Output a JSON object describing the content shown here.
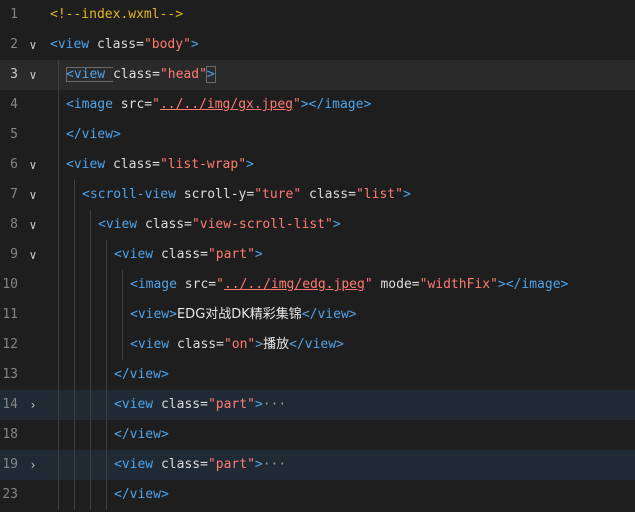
{
  "lines": [
    {
      "num": "1",
      "fold": "",
      "code": [
        {
          "t": "comment",
          "v": "<!--index.wxml-->"
        }
      ]
    },
    {
      "num": "2",
      "fold": "open",
      "code": [
        {
          "t": "tag",
          "v": "<view "
        },
        {
          "t": "attr",
          "v": "class"
        },
        {
          "t": "eq",
          "v": "="
        },
        {
          "t": "str",
          "v": "\"body\""
        },
        {
          "t": "tag",
          "v": ">"
        }
      ]
    },
    {
      "num": "3",
      "fold": "open",
      "current": true,
      "code": [
        {
          "t": "tag",
          "v": "<view "
        },
        {
          "t": "attr",
          "v": "class"
        },
        {
          "t": "eq",
          "v": "="
        },
        {
          "t": "str",
          "v": "\"head\""
        },
        {
          "t": "tag",
          "v": ">"
        }
      ]
    },
    {
      "num": "4",
      "fold": "",
      "code": [
        {
          "t": "tag",
          "v": "<image "
        },
        {
          "t": "attr",
          "v": "src"
        },
        {
          "t": "eq",
          "v": "="
        },
        {
          "t": "str",
          "v": "\""
        },
        {
          "t": "link",
          "v": "../../img/gx.jpeg"
        },
        {
          "t": "str",
          "v": "\""
        },
        {
          "t": "tag",
          "v": "></image>"
        }
      ]
    },
    {
      "num": "5",
      "fold": "",
      "code": [
        {
          "t": "tag",
          "v": "</view>"
        }
      ]
    },
    {
      "num": "6",
      "fold": "open",
      "code": [
        {
          "t": "tag",
          "v": "<view "
        },
        {
          "t": "attr",
          "v": "class"
        },
        {
          "t": "eq",
          "v": "="
        },
        {
          "t": "str",
          "v": "\"list-wrap\""
        },
        {
          "t": "tag",
          "v": ">"
        }
      ]
    },
    {
      "num": "7",
      "fold": "open",
      "code": [
        {
          "t": "tag",
          "v": "<scroll-view "
        },
        {
          "t": "attr",
          "v": "scroll-y"
        },
        {
          "t": "eq",
          "v": "="
        },
        {
          "t": "str",
          "v": "\"ture\""
        },
        {
          "t": "attr",
          "v": " class"
        },
        {
          "t": "eq",
          "v": "="
        },
        {
          "t": "str",
          "v": "\"list\""
        },
        {
          "t": "tag",
          "v": ">"
        }
      ]
    },
    {
      "num": "8",
      "fold": "open",
      "code": [
        {
          "t": "tag",
          "v": "<view "
        },
        {
          "t": "attr",
          "v": "class"
        },
        {
          "t": "eq",
          "v": "="
        },
        {
          "t": "str",
          "v": "\"view-scroll-list\""
        },
        {
          "t": "tag",
          "v": ">"
        }
      ]
    },
    {
      "num": "9",
      "fold": "open",
      "code": [
        {
          "t": "tag",
          "v": "<view "
        },
        {
          "t": "attr",
          "v": "class"
        },
        {
          "t": "eq",
          "v": "="
        },
        {
          "t": "str",
          "v": "\"part\""
        },
        {
          "t": "tag",
          "v": ">"
        }
      ]
    },
    {
      "num": "10",
      "fold": "",
      "code": [
        {
          "t": "tag",
          "v": "<image "
        },
        {
          "t": "attr",
          "v": "src"
        },
        {
          "t": "eq",
          "v": "="
        },
        {
          "t": "str",
          "v": "\""
        },
        {
          "t": "link",
          "v": "../../img/edg.jpeg"
        },
        {
          "t": "str",
          "v": "\""
        },
        {
          "t": "attr",
          "v": " mode"
        },
        {
          "t": "eq",
          "v": "="
        },
        {
          "t": "str",
          "v": "\"widthFix\""
        },
        {
          "t": "tag",
          "v": "></image>"
        }
      ]
    },
    {
      "num": "11",
      "fold": "",
      "code": [
        {
          "t": "tag",
          "v": "<view>"
        },
        {
          "t": "text",
          "v": "EDG对战DK精彩集锦"
        },
        {
          "t": "tag",
          "v": "</view>"
        }
      ]
    },
    {
      "num": "12",
      "fold": "",
      "code": [
        {
          "t": "tag",
          "v": "<view "
        },
        {
          "t": "attr",
          "v": "class"
        },
        {
          "t": "eq",
          "v": "="
        },
        {
          "t": "str",
          "v": "\"on\""
        },
        {
          "t": "tag",
          "v": ">"
        },
        {
          "t": "text",
          "v": "播放"
        },
        {
          "t": "tag",
          "v": "</view>"
        }
      ]
    },
    {
      "num": "13",
      "fold": "",
      "code": [
        {
          "t": "tag",
          "v": "</view>"
        }
      ]
    },
    {
      "num": "14",
      "fold": "closed",
      "folded": true,
      "code": [
        {
          "t": "tag",
          "v": "<view "
        },
        {
          "t": "attr",
          "v": "class"
        },
        {
          "t": "eq",
          "v": "="
        },
        {
          "t": "str",
          "v": "\"part\""
        },
        {
          "t": "tag",
          "v": ">"
        },
        {
          "t": "ell",
          "v": "···"
        }
      ]
    },
    {
      "num": "18",
      "fold": "",
      "code": [
        {
          "t": "tag",
          "v": "</view>"
        }
      ]
    },
    {
      "num": "19",
      "fold": "closed",
      "folded": true,
      "code": [
        {
          "t": "tag",
          "v": "<view "
        },
        {
          "t": "attr",
          "v": "class"
        },
        {
          "t": "eq",
          "v": "="
        },
        {
          "t": "str",
          "v": "\"part\""
        },
        {
          "t": "tag",
          "v": ">"
        },
        {
          "t": "ell",
          "v": "···"
        }
      ]
    },
    {
      "num": "23",
      "fold": "",
      "code": [
        {
          "t": "tag",
          "v": "</view>"
        }
      ]
    }
  ],
  "fold_glyphs": {
    "open": "∨",
    "closed": "›"
  }
}
